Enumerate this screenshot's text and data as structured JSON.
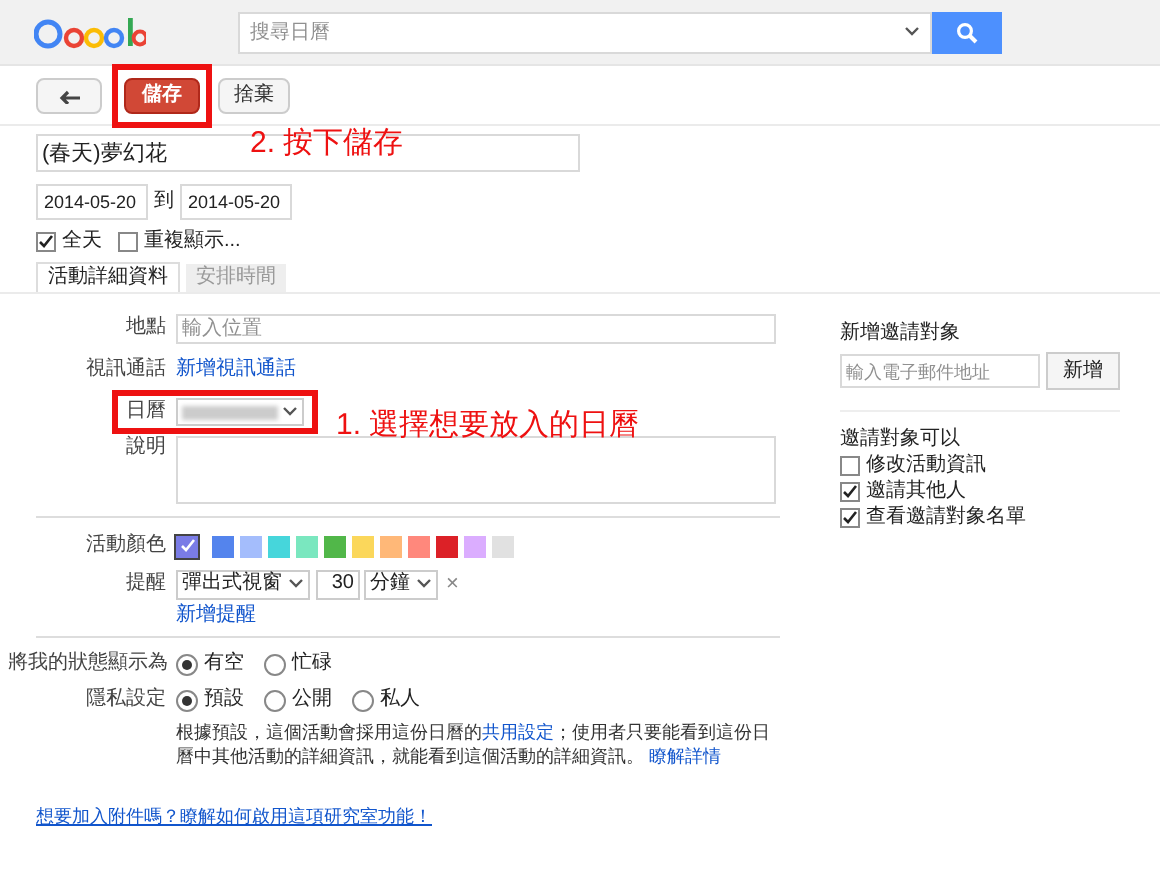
{
  "header": {
    "search": {
      "placeholder": "搜尋日曆"
    }
  },
  "toolbar": {
    "buttons": [
      {
        "kind": "back"
      },
      {
        "kind": "primary",
        "label": "儲存"
      },
      {
        "kind": "plain",
        "label": "捨棄"
      }
    ]
  },
  "event": {
    "title": "(春天)夢幻花",
    "start_date": "2014-05-20",
    "to": "到",
    "end_date": "2014-05-20",
    "options": [
      {
        "label": "全天",
        "checked": true
      },
      {
        "label": "重複顯示...",
        "checked": false
      }
    ]
  },
  "tabs": [
    {
      "label": "活動詳細資料",
      "selected": true
    },
    {
      "label": "安排時間",
      "selected": false
    }
  ],
  "details": {
    "location": {
      "label": "地點",
      "placeholder": "輸入位置"
    },
    "video": {
      "label": "視訊通話",
      "link": "新增視訊通話"
    },
    "calendar": {
      "label": "日曆"
    },
    "description": {
      "label": "說明"
    },
    "color": {
      "label": "活動顏色",
      "swatches": [
        {
          "color": "#7a7ce6",
          "selected": true
        },
        {
          "color": "#5484ed",
          "selected": false
        },
        {
          "color": "#a4bdfc",
          "selected": false
        },
        {
          "color": "#46d6db",
          "selected": false
        },
        {
          "color": "#7ae7bf",
          "selected": false
        },
        {
          "color": "#51b749",
          "selected": false
        },
        {
          "color": "#fbd75b",
          "selected": false
        },
        {
          "color": "#ffb878",
          "selected": false
        },
        {
          "color": "#ff887c",
          "selected": false
        },
        {
          "color": "#dc2127",
          "selected": false
        },
        {
          "color": "#dbadff",
          "selected": false
        },
        {
          "color": "#e1e1e1",
          "selected": false
        }
      ]
    },
    "reminder": {
      "label": "提醒",
      "method": "彈出式視窗",
      "amount": "30",
      "unit": "分鐘",
      "remove": "×",
      "add_link": "新增提醒"
    },
    "status": {
      "label": "將我的狀態顯示為",
      "choices": [
        {
          "label": "有空",
          "selected": true
        },
        {
          "label": "忙碌",
          "selected": false
        }
      ]
    },
    "privacy": {
      "label": "隱私設定",
      "choices": [
        {
          "label": "預設",
          "selected": true
        },
        {
          "label": "公開",
          "selected": false
        },
        {
          "label": "私人",
          "selected": false
        }
      ]
    },
    "privacy_note": {
      "before": "根據預設，這個活動會採用這份日曆的",
      "link": "共用設定",
      "after": "；使用者只要能看到這份日曆中其他活動的詳細資訊，就能看到這個活動的詳細資訊。",
      "more_link": "瞭解詳情"
    }
  },
  "attachments_link": "想要加入附件嗎？瞭解如何啟用這項研究室功能！",
  "guests": {
    "title": "新增邀請對象",
    "placeholder": "輸入電子郵件地址",
    "add_button": "新增",
    "permissions_title": "邀請對象可以",
    "permissions": [
      {
        "label": "修改活動資訊",
        "checked": false
      },
      {
        "label": "邀請其他人",
        "checked": true
      },
      {
        "label": "查看邀請對象名單",
        "checked": true
      }
    ]
  },
  "annotations": [
    {
      "text": "2. 按下儲存"
    },
    {
      "text": "1. 選擇想要放入的日曆"
    }
  ]
}
